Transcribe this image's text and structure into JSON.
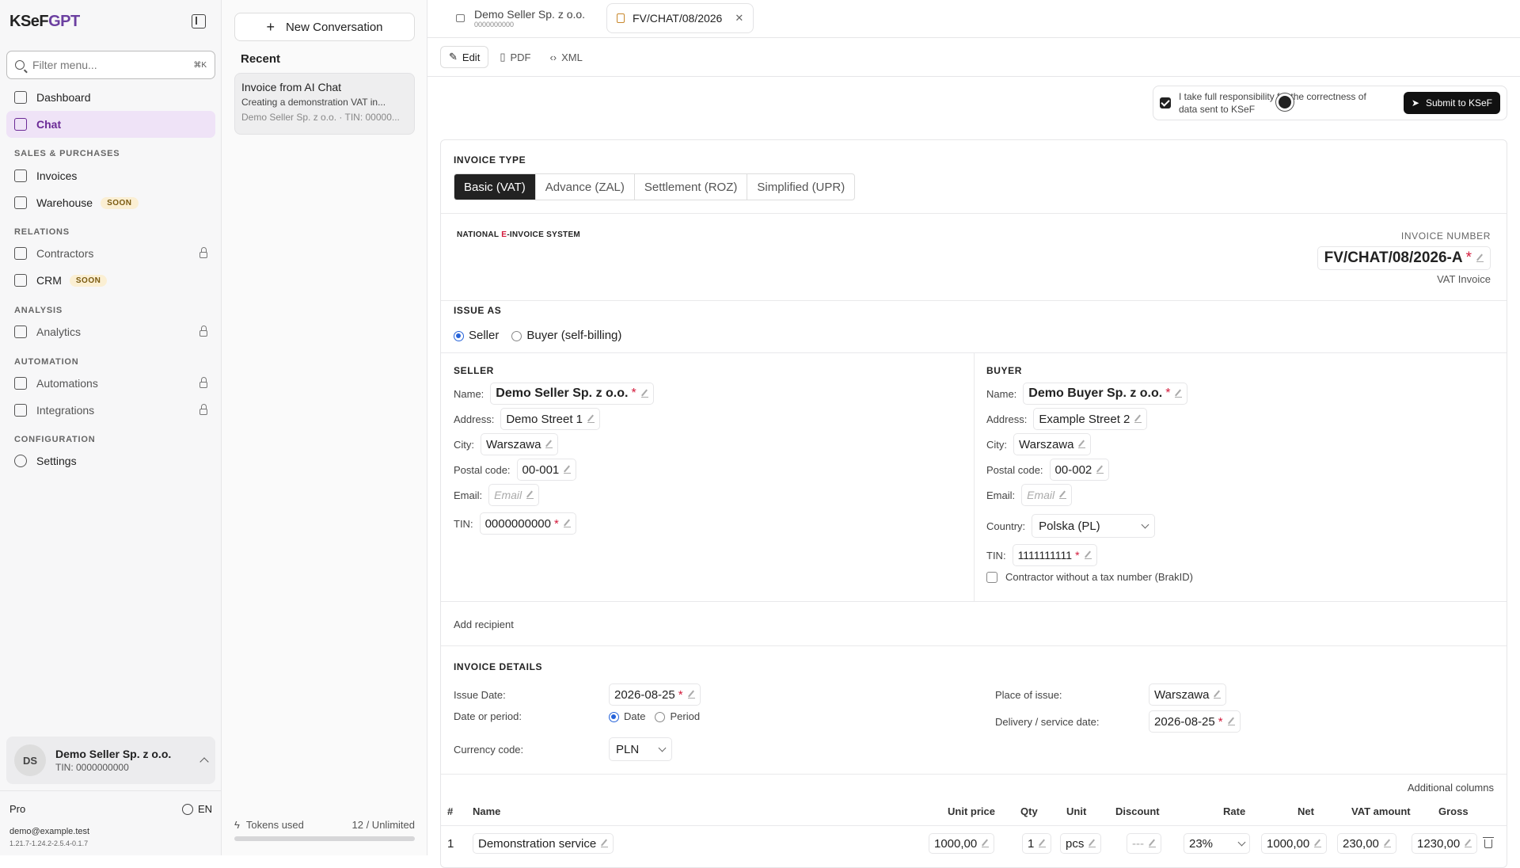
{
  "sidebar": {
    "logo": "KSeF",
    "logo_accent": "GPT",
    "filter_placeholder": "Filter menu...",
    "filter_shortcut": "⌘K",
    "items": [
      {
        "label": "Dashboard"
      },
      {
        "label": "Chat"
      },
      {
        "label": "Invoices"
      },
      {
        "label": "Warehouse",
        "badge": "SOON"
      },
      {
        "label": "Contractors"
      },
      {
        "label": "CRM",
        "badge": "SOON"
      },
      {
        "label": "Analytics"
      },
      {
        "label": "Automations"
      },
      {
        "label": "Integrations"
      },
      {
        "label": "Settings"
      }
    ],
    "sections": {
      "sales": "SALES & PURCHASES",
      "relations": "RELATIONS",
      "analysis": "ANALYSIS",
      "automation": "AUTOMATION",
      "configuration": "CONFIGURATION"
    },
    "account": {
      "initials": "DS",
      "name": "Demo Seller Sp. z o.o.",
      "tin": "TIN: 0000000000"
    },
    "plan": "Pro",
    "lang": "EN",
    "email": "demo@example.test",
    "version": "1.21.7-1.24.2-2.5.4-0.1.7"
  },
  "conversations": {
    "new_label": "New Conversation",
    "recent_label": "Recent",
    "items": [
      {
        "title": "Invoice from AI Chat",
        "preview": "Creating a demonstration VAT in...",
        "meta": "Demo Seller Sp. z o.o. · TIN: 00000..."
      }
    ],
    "tokens_label": "Tokens used",
    "tokens_value": "12 / Unlimited"
  },
  "tabs": [
    {
      "title": "Demo Seller Sp. z o.o.",
      "sub": "0000000000"
    },
    {
      "title": "FV/CHAT/08/2026"
    }
  ],
  "modes": [
    "Edit",
    "PDF",
    "XML"
  ],
  "responsibility": {
    "text": "I take full responsibility for the correctness of data sent to KSeF",
    "submit": "Submit to KSeF"
  },
  "invoice": {
    "type_label": "INVOICE TYPE",
    "types": [
      "Basic (VAT)",
      "Advance (ZAL)",
      "Settlement (ROZ)",
      "Simplified (UPR)"
    ],
    "system_pre": "NATIONAL ",
    "system_e": "E",
    "system_post": "-INVOICE SYSTEM",
    "number_label": "INVOICE NUMBER",
    "number": "FV/CHAT/08/2026-A",
    "kind": "VAT Invoice",
    "issue_as_label": "ISSUE AS",
    "issue_as": [
      "Seller",
      "Buyer (self-billing)"
    ],
    "seller": {
      "heading": "SELLER",
      "labels": {
        "name": "Name:",
        "address": "Address:",
        "city": "City:",
        "postal": "Postal code:",
        "email": "Email:",
        "tin": "TIN:"
      },
      "name": "Demo Seller Sp. z o.o.",
      "address": "Demo Street 1",
      "city": "Warszawa",
      "postal": "00-001",
      "email_placeholder": "Email",
      "tin": "0000000000"
    },
    "buyer": {
      "heading": "BUYER",
      "labels": {
        "name": "Name:",
        "address": "Address:",
        "city": "City:",
        "postal": "Postal code:",
        "email": "Email:",
        "country": "Country:",
        "tin": "TIN:"
      },
      "name": "Demo Buyer Sp. z o.o.",
      "address": "Example Street 2",
      "city": "Warszawa",
      "postal": "00-002",
      "email_placeholder": "Email",
      "country": "Polska (PL)",
      "tin": "1111111111",
      "no_tax_label": "Contractor without a tax number (BrakID)"
    },
    "add_recipient": "Add recipient",
    "details": {
      "heading": "INVOICE DETAILS",
      "issue_date_label": "Issue Date:",
      "issue_date": "2026-08-25",
      "date_period_label": "Date or period:",
      "date_option": "Date",
      "period_option": "Period",
      "currency_label": "Currency code:",
      "currency": "PLN",
      "place_label": "Place of issue:",
      "place": "Warszawa",
      "delivery_label": "Delivery / service date:",
      "delivery": "2026-08-25"
    },
    "additional_columns": "Additional columns",
    "table": {
      "headers": {
        "num": "#",
        "name": "Name",
        "unit_price": "Unit price",
        "qty": "Qty",
        "unit": "Unit",
        "discount": "Discount",
        "rate": "Rate",
        "net": "Net",
        "vat": "VAT amount",
        "gross": "Gross"
      },
      "rows": [
        {
          "num": "1",
          "name": "Demonstration service",
          "unit_price": "1000,00",
          "qty": "1",
          "unit": "pcs",
          "discount": "---",
          "rate": "23%",
          "net": "1000,00",
          "vat": "230,00",
          "gross": "1230,00"
        }
      ]
    }
  }
}
